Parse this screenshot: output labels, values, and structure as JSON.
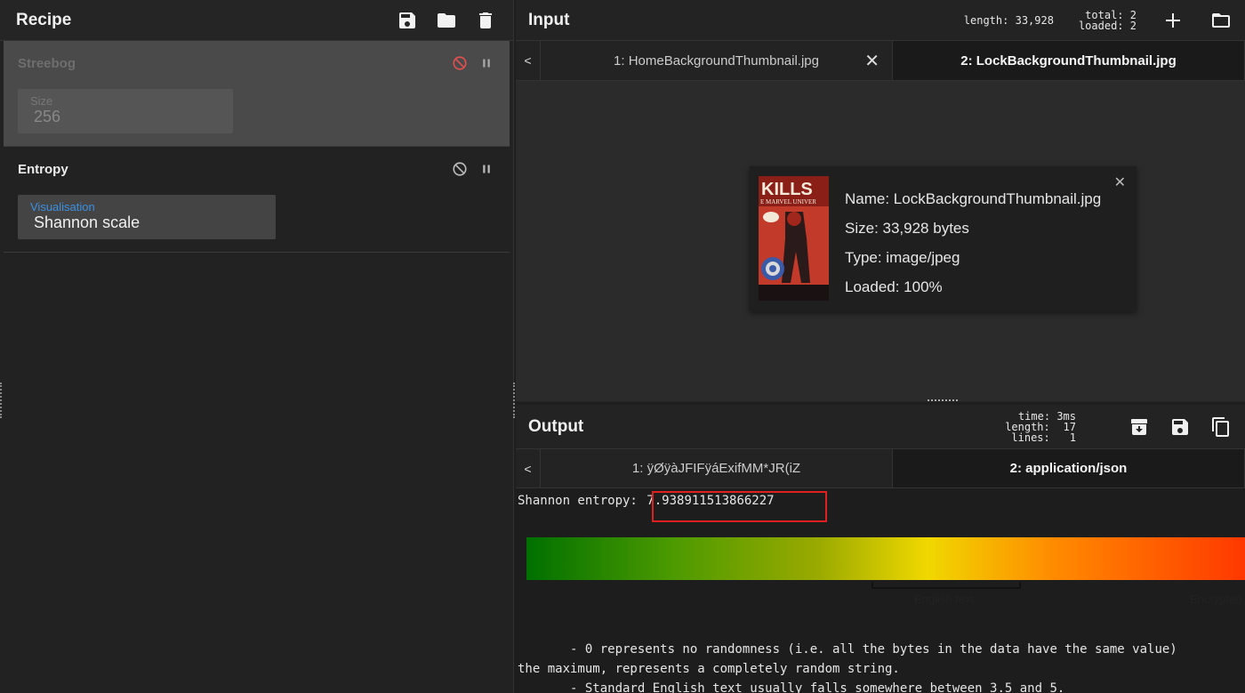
{
  "recipe": {
    "title": "Recipe",
    "operations": [
      {
        "name": "Streebog",
        "disabled": true,
        "arg_label": "Size",
        "arg_value": "256"
      },
      {
        "name": "Entropy",
        "disabled": false,
        "arg_label": "Visualisation",
        "arg_value": "Shannon scale"
      }
    ]
  },
  "input": {
    "title": "Input",
    "length_label": "length:",
    "length_value": "33,928",
    "total_label": "total:",
    "total_value": "2",
    "loaded_label": "loaded:",
    "loaded_value": "2",
    "tab_prev": "<",
    "tabs": [
      {
        "label": "1: HomeBackgroundThumbnail.jpg",
        "close": "✕"
      },
      {
        "label": "2: LockBackgroundThumbnail.jpg"
      }
    ],
    "file": {
      "name": "Name: LockBackgroundThumbnail.jpg",
      "size": "Size: 33,928 bytes",
      "type": "Type: image/jpeg",
      "loaded": "Loaded: 100%",
      "thumb_text": "KILLS",
      "thumb_subtext": "E MARVEL UNIVER",
      "close": "✕"
    }
  },
  "output": {
    "title": "Output",
    "time_label": "time:",
    "time_value": "3ms",
    "length_label": "length:",
    "length_value": "17",
    "lines_label": "lines:",
    "lines_value": "1",
    "tab_prev": "<",
    "tabs": [
      {
        "label": "1: ÿØÿàJFIFÿáExifMM*JR(iZ"
      },
      {
        "label": "2: application/json"
      }
    ],
    "entropy_label": "Shannon entropy: ",
    "entropy_value": "7.938911513866227",
    "scale_english": "English text",
    "scale_encrypted": "Encrypted",
    "notes": "       - 0 represents no randomness (i.e. all the bytes in the data have the same value)\nthe maximum, represents a completely random string.\n       - Standard English text usually falls somewhere between 3.5 and 5."
  },
  "colors": {
    "accent_blue": "#3d8fe0",
    "disable_red": "#e05050",
    "highlight_red": "#e02020"
  },
  "icons": [
    "save-icon",
    "folder-icon",
    "trash-icon",
    "disable-icon",
    "pause-icon",
    "plus-icon",
    "close-icon",
    "archive-icon",
    "copy-icon"
  ]
}
